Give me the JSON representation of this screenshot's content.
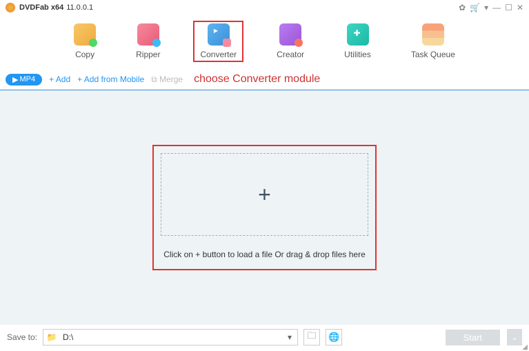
{
  "titlebar": {
    "app_name": "DVDFab x64",
    "version": "11.0.0.1"
  },
  "nav": {
    "copy": "Copy",
    "ripper": "Ripper",
    "converter": "Converter",
    "creator": "Creator",
    "utilities": "Utilities",
    "task_queue": "Task Queue"
  },
  "toolbar": {
    "format_badge": "MP4",
    "add": "+  Add",
    "add_mobile": "+  Add from Mobile",
    "merge": "Merge"
  },
  "annotation": "choose Converter module",
  "dropzone": {
    "plus": "+",
    "text": "Click on + button to load a file Or drag & drop files here"
  },
  "footer": {
    "save_to": "Save to:",
    "path": "D:\\",
    "start": "Start"
  }
}
